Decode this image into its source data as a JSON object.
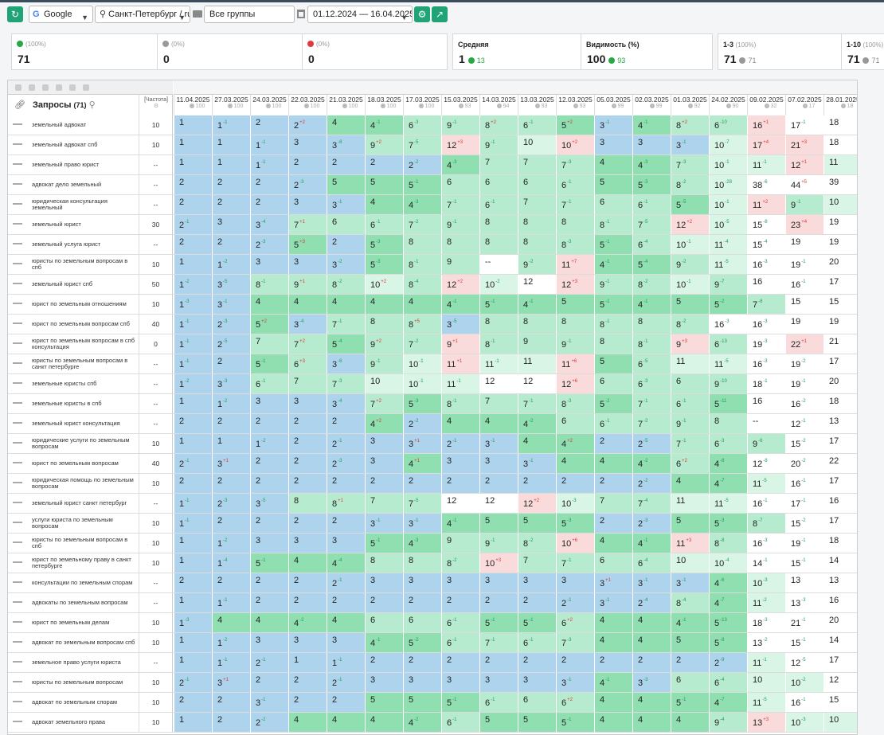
{
  "toolbar": {
    "engine": "Google",
    "region": "Санкт-Петербург / ru",
    "group": "Все группы",
    "period": "01.12.2024 — 16.04.2025"
  },
  "cards": [
    {
      "label": "(100%)",
      "value": "71",
      "color": "#28a745"
    },
    {
      "label": "(0%)",
      "value": "0",
      "color": "#999"
    },
    {
      "label": "(0%)",
      "value": "0",
      "color": "#e0393e"
    }
  ],
  "card_avg": {
    "title": "Средняя",
    "value": "1",
    "delta": "13"
  },
  "card_vis": {
    "title": "Видимость (%)",
    "value": "100",
    "delta": "93"
  },
  "card_top3": {
    "title": "1-3",
    "pct": "(100%)",
    "value": "71",
    "delta": "71"
  },
  "card_top10": {
    "title": "1-10",
    "pct": "(100%)",
    "value": "71",
    "delta": "71"
  },
  "table": {
    "header_query": "Запросы",
    "query_count": "(71)",
    "header_freq": "[Частота]",
    "dates": [
      "11.04.2025",
      "27.03.2025",
      "24.03.2025",
      "22.03.2025",
      "21.03.2025",
      "18.03.2025",
      "17.03.2025",
      "15.03.2025",
      "14.03.2025",
      "13.03.2025",
      "12.03.2025",
      "05.03.2025",
      "02.03.2025",
      "01.03.2025",
      "24.02.2025",
      "09.02.2025",
      "07.02.2025",
      "28.01.2025"
    ],
    "visibility": [
      "100",
      "100",
      "100",
      "100",
      "100",
      "100",
      "100",
      "93",
      "94",
      "93",
      "93",
      "99",
      "99",
      "92",
      "90",
      "32",
      "17",
      "18"
    ],
    "rows": [
      {
        "q": "земельный адвокат",
        "f": "10",
        "p": [
          "1",
          "1 -1",
          "2",
          "2 +2",
          "4",
          "4 -1",
          "6 -3",
          "9 -1",
          "8 +2",
          "6 -1",
          "5 +2",
          "3 -1",
          "4 -1",
          "8 +2",
          "6 -10",
          "16 +1",
          "17 -1",
          "18"
        ]
      },
      {
        "q": "земельный адвокат спб",
        "f": "10",
        "p": [
          "1",
          "1",
          "1 -1",
          "3",
          "3 -8",
          "9 +2",
          "7 -5",
          "12 +3",
          "9 -1",
          "10",
          "10 +2",
          "3",
          "3",
          "3 -1",
          "10 -7",
          "17 +4",
          "21 +3",
          "18"
        ]
      },
      {
        "q": "земельный право юрист",
        "f": "--",
        "p": [
          "1",
          "1",
          "1 -1",
          "2",
          "2",
          "2",
          "2 -2",
          "4 -3",
          "7",
          "7",
          "7 -3",
          "4",
          "4 -3",
          "7 -3",
          "10 -1",
          "11 -1",
          "12 +1",
          "11"
        ]
      },
      {
        "q": "адвокат дело земельный",
        "f": "--",
        "p": [
          "2",
          "2",
          "2",
          "2 -3",
          "5",
          "5",
          "5 -1",
          "6",
          "6",
          "6",
          "6 -1",
          "5",
          "5 -3",
          "8 -2",
          "10 -28",
          "38 -6",
          "44 +5",
          "39"
        ]
      },
      {
        "q": "юридическая консультация земельный",
        "f": "--",
        "p": [
          "2",
          "2",
          "2",
          "3",
          "3 -1",
          "4",
          "4 -3",
          "7 -1",
          "6 -1",
          "7",
          "7 -1",
          "6",
          "6 -1",
          "5 -5",
          "10 -1",
          "11 +2",
          "9 -1",
          "10"
        ]
      },
      {
        "q": "земельный юрист",
        "f": "30",
        "p": [
          "2 -1",
          "3",
          "3 -4",
          "7 +1",
          "6",
          "6 -1",
          "7 -2",
          "9 -1",
          "8",
          "8",
          "8",
          "8 -1",
          "7 -5",
          "12 +2",
          "10 -5",
          "15 -8",
          "23 +4",
          "19"
        ]
      },
      {
        "q": "земельный услуга юрист",
        "f": "--",
        "p": [
          "2",
          "2",
          "2 -3",
          "5 +3",
          "2",
          "5 -3",
          "8",
          "8",
          "8",
          "8",
          "8 -3",
          "5 -1",
          "6 -4",
          "10 -1",
          "11 -4",
          "15 -4",
          "19",
          "19"
        ]
      },
      {
        "q": "юристы по земельным вопросам в спб",
        "f": "10",
        "p": [
          "1",
          "1 -2",
          "3",
          "3",
          "3 -2",
          "5 -3",
          "8 -1",
          "9",
          "--",
          "9 -2",
          "11 +7",
          "4 -1",
          "5 -4",
          "9 -2",
          "11 -5",
          "16 -3",
          "19 -1",
          "20"
        ]
      },
      {
        "q": "земельный юрист спб",
        "f": "50",
        "p": [
          "1 -2",
          "3 -5",
          "8 -1",
          "9 +1",
          "8 -2",
          "10 +2",
          "8 -4",
          "12 +2",
          "10 -2",
          "12",
          "12 +3",
          "9 -1",
          "8 -2",
          "10 -1",
          "9 -7",
          "16",
          "16 -1",
          "17"
        ]
      },
      {
        "q": "юрист по земельным отношениям",
        "f": "10",
        "p": [
          "1 -3",
          "3 -1",
          "4",
          "4",
          "4",
          "4",
          "4",
          "4 -1",
          "5 -1",
          "4 -1",
          "5",
          "5 -1",
          "4 -1",
          "5",
          "5 -2",
          "7 -8",
          "15",
          "15"
        ]
      },
      {
        "q": "юрист по земельным вопросам спб",
        "f": "40",
        "p": [
          "1 -1",
          "2 -3",
          "5 +2",
          "3 -4",
          "7 -1",
          "8",
          "8 +5",
          "3 -5",
          "8",
          "8",
          "8",
          "8 -1",
          "8",
          "8 -2",
          "16 -3",
          "16 -3",
          "19",
          "19"
        ]
      },
      {
        "q": "юрист по земельным вопросам в спб консультация",
        "f": "0",
        "p": [
          "1 -1",
          "2 -5",
          "7",
          "7 +2",
          "5 -4",
          "9 +2",
          "7 -2",
          "9 +1",
          "8 -1",
          "9",
          "9 -1",
          "8",
          "8 -1",
          "9 +3",
          "6 -13",
          "19 -3",
          "22 +1",
          "21"
        ]
      },
      {
        "q": "юристы по земельным вопросам в санкт петербурге",
        "f": "--",
        "p": [
          "1 -1",
          "2",
          "5 -1",
          "6 +3",
          "3 -6",
          "9 -1",
          "10 -1",
          "11 +1",
          "11 -1",
          "11",
          "11 +6",
          "5",
          "6 -5",
          "11",
          "11 -5",
          "16 -3",
          "19 -2",
          "17"
        ]
      },
      {
        "q": "земельные юристы спб",
        "f": "--",
        "p": [
          "1 -2",
          "3 -3",
          "6 -1",
          "7",
          "7 -3",
          "10",
          "10 -1",
          "11 -1",
          "12",
          "12",
          "12 +6",
          "6",
          "6 -3",
          "6",
          "9 -10",
          "18 -1",
          "19 -1",
          "20"
        ]
      },
      {
        "q": "земельные юристы в спб",
        "f": "--",
        "p": [
          "1",
          "1 -2",
          "3",
          "3",
          "3 -4",
          "7 +2",
          "5 -3",
          "8 -1",
          "7",
          "7 -1",
          "8 -3",
          "5 -2",
          "7 -1",
          "6 -1",
          "5 -11",
          "16",
          "16 -2",
          "18"
        ]
      },
      {
        "q": "земельный юрист консультация",
        "f": "--",
        "p": [
          "2",
          "2",
          "2",
          "2",
          "2",
          "4 +2",
          "2 -2",
          "4",
          "4",
          "4 -2",
          "6",
          "6 -1",
          "7 -2",
          "9 -1",
          "8",
          "--",
          "12 -1",
          "13"
        ]
      },
      {
        "q": "юридические услуги по земельным вопросам",
        "f": "10",
        "p": [
          "1",
          "1",
          "1 -2",
          "2",
          "2 -1",
          "3",
          "3 +1",
          "2 -1",
          "3 -1",
          "4",
          "4 +2",
          "2",
          "2 -5",
          "7 -1",
          "6 -3",
          "9 -6",
          "15 -2",
          "17"
        ]
      },
      {
        "q": "юрист по земельным вопросам",
        "f": "40",
        "p": [
          "2 -1",
          "3 +1",
          "2",
          "2",
          "2 -3",
          "3",
          "4 +1",
          "3",
          "3",
          "3 -1",
          "4",
          "4",
          "4 -2",
          "6 +2",
          "4 -8",
          "12 -8",
          "20 -2",
          "22"
        ]
      },
      {
        "q": "юридическая помощь по земельным вопросам",
        "f": "10",
        "p": [
          "2",
          "2",
          "2",
          "2",
          "2",
          "2",
          "2",
          "2",
          "2",
          "2",
          "2",
          "2",
          "2 -2",
          "4",
          "4 -7",
          "11 -5",
          "16 -1",
          "17"
        ]
      },
      {
        "q": "земельный юрист санкт петербург",
        "f": "--",
        "p": [
          "1 -1",
          "2 -3",
          "3 -5",
          "8",
          "8 +1",
          "7",
          "7 -5",
          "12",
          "12",
          "12 +2",
          "10 -3",
          "7",
          "7 -4",
          "11",
          "11 -5",
          "16 -1",
          "17 -1",
          "16"
        ]
      },
      {
        "q": "услуги юриста по земельным вопросам",
        "f": "10",
        "p": [
          "1 -1",
          "2",
          "2",
          "2",
          "2",
          "3 -1",
          "3 -1",
          "4 -1",
          "5",
          "5",
          "5 -3",
          "2",
          "2 -3",
          "5",
          "5 -3",
          "8 -7",
          "15 -2",
          "17"
        ]
      },
      {
        "q": "юристы по земельным вопросам в спб",
        "f": "10",
        "p": [
          "1",
          "1 -2",
          "3",
          "3",
          "3",
          "5 -1",
          "4 -3",
          "9",
          "9 -1",
          "8 -2",
          "10 +6",
          "4",
          "4 -1",
          "11 +3",
          "8 -8",
          "16 -3",
          "19 -1",
          "18"
        ]
      },
      {
        "q": "юрист по земельному праву в санкт петербурге",
        "f": "10",
        "p": [
          "1",
          "1 -4",
          "5 -1",
          "4",
          "4 -4",
          "8",
          "8",
          "8 -2",
          "10 +3",
          "7",
          "7 -1",
          "6",
          "6 -4",
          "10",
          "10 -4",
          "14 -1",
          "15 -1",
          "14"
        ]
      },
      {
        "q": "консультации по земельным спорам",
        "f": "--",
        "p": [
          "2",
          "2",
          "2",
          "2",
          "2 -1",
          "3",
          "3",
          "3",
          "3",
          "3",
          "3",
          "3 +1",
          "3 -1",
          "3 -1",
          "4 -6",
          "10 -3",
          "13",
          "13"
        ]
      },
      {
        "q": "адвокаты по земельным вопросам",
        "f": "--",
        "p": [
          "1",
          "1 -1",
          "2",
          "2",
          "2",
          "2",
          "2",
          "2",
          "2",
          "2",
          "2 -1",
          "3 -1",
          "2 -4",
          "8 -4",
          "4 -7",
          "11 -2",
          "13 -3",
          "16"
        ]
      },
      {
        "q": "юрист по земельным делам",
        "f": "10",
        "p": [
          "1 -3",
          "4",
          "4",
          "4 -2",
          "4",
          "6",
          "6",
          "6 -1",
          "5 -1",
          "5 -1",
          "6 +2",
          "4",
          "4",
          "4 -1",
          "5 -13",
          "18 -3",
          "21 -1",
          "20"
        ]
      },
      {
        "q": "адвокат по земельным вопросам спб",
        "f": "10",
        "p": [
          "1",
          "1 -2",
          "3",
          "3",
          "3",
          "4 -1",
          "5 -2",
          "6 -1",
          "7 -1",
          "6 -1",
          "7 -3",
          "4",
          "4",
          "5",
          "5 -8",
          "13 -2",
          "15 -1",
          "14"
        ]
      },
      {
        "q": "земельное право услуги юриста",
        "f": "--",
        "p": [
          "1",
          "1 -1",
          "2 -1",
          "1",
          "1 -1",
          "2",
          "2",
          "2",
          "2",
          "2",
          "2",
          "2",
          "2",
          "2",
          "2 -9",
          "11 -1",
          "12 -5",
          "17"
        ]
      },
      {
        "q": "юристы по земельным вопросам",
        "f": "10",
        "p": [
          "2 -1",
          "3 +1",
          "2",
          "2",
          "2 -1",
          "3",
          "3",
          "3",
          "3",
          "3",
          "3 -1",
          "4 -1",
          "3 -3",
          "6",
          "6 -4",
          "10",
          "10 -2",
          "12"
        ]
      },
      {
        "q": "адвокат по земельным спорам",
        "f": "10",
        "p": [
          "2",
          "2",
          "3 -1",
          "2",
          "2",
          "5",
          "5",
          "5 -1",
          "6 -1",
          "6",
          "6 +2",
          "4",
          "4",
          "5 -1",
          "4 -7",
          "11 -5",
          "16 -1",
          "15"
        ]
      },
      {
        "q": "адвокат земельного права",
        "f": "10",
        "p": [
          "1",
          "2",
          "2 -2",
          "4",
          "4",
          "4",
          "4 -2",
          "6 -1",
          "5",
          "5",
          "5 -1",
          "4",
          "4",
          "4",
          "9 -4",
          "13 +3",
          "10 -3",
          "10"
        ]
      }
    ]
  }
}
